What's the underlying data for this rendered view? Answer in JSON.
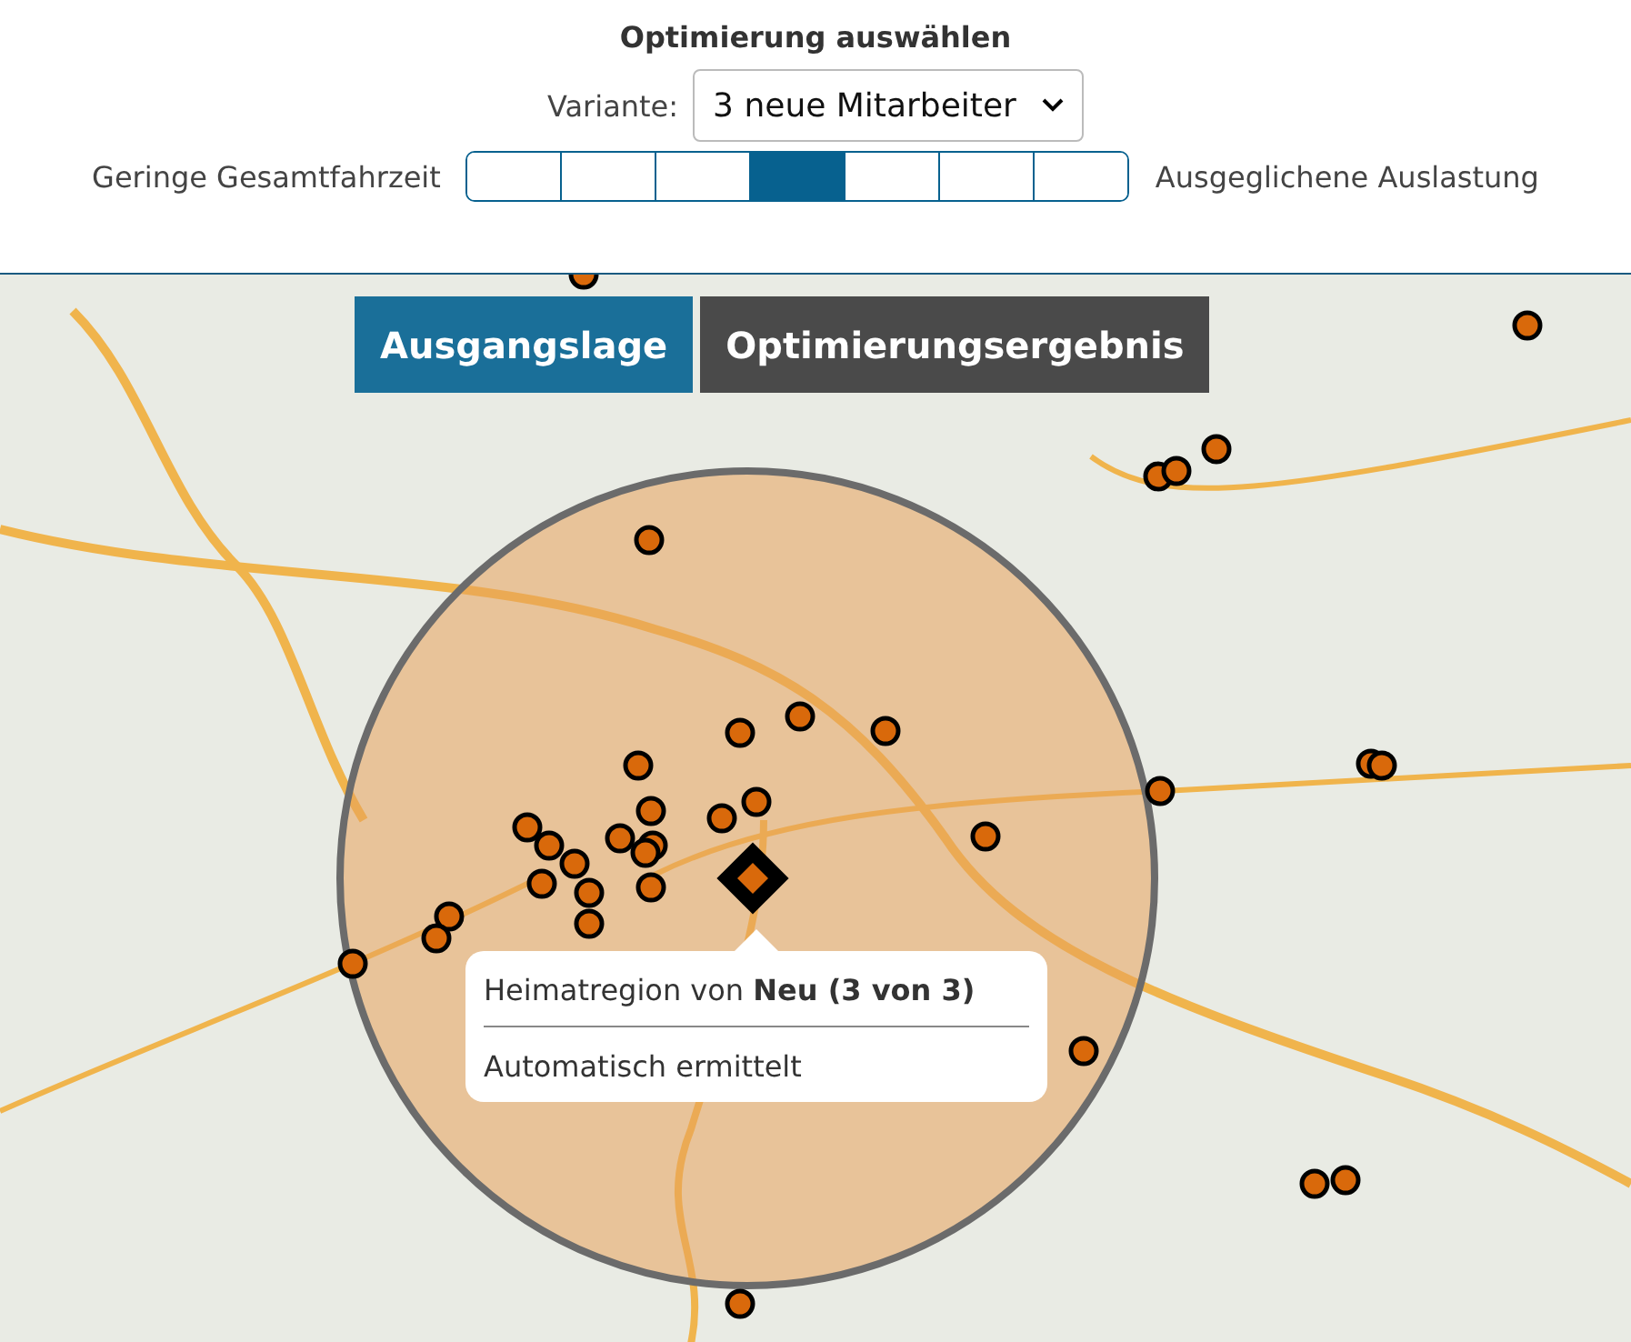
{
  "title": "Optimierung auswählen",
  "variant": {
    "label": "Variante:",
    "value": "3 neue Mitarbeiter"
  },
  "balance": {
    "left_label": "Geringe Gesamtfahrzeit",
    "right_label": "Ausgeglichene Auslastung",
    "segments": [
      {
        "selected": false
      },
      {
        "selected": false
      },
      {
        "selected": false
      },
      {
        "selected": true
      },
      {
        "selected": false
      },
      {
        "selected": false
      },
      {
        "selected": false
      }
    ]
  },
  "map": {
    "tabs": [
      {
        "label": "Ausgangslage",
        "selected": true
      },
      {
        "label": "Optimierungsergebnis",
        "selected": false
      }
    ],
    "tooltip": {
      "title": "Heimatregion von **Neu (3 von 3)**",
      "subtitle": "Automatisch ermittelt"
    }
  }
}
